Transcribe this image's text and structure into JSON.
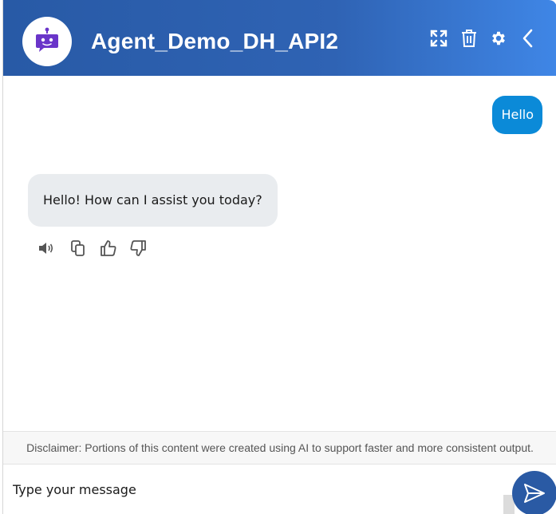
{
  "header": {
    "title": "Agent_Demo_DH_API2",
    "avatar_icon": "robot-icon",
    "actions": [
      "expand-icon",
      "trash-icon",
      "gear-icon",
      "chevron-left-icon"
    ],
    "gradient_start": "#285aa6",
    "gradient_end": "#3f86e6"
  },
  "conversation": {
    "user_message": "Hello",
    "bot_message": "Hello! How can I assist you today?",
    "bot_actions": [
      "speaker-icon",
      "copy-icon",
      "thumbs-up-icon",
      "thumbs-down-icon"
    ],
    "user_bubble_color": "#0b8ad8",
    "bot_bubble_color": "#e9ecef"
  },
  "disclaimer": {
    "text": "Disclaimer: Portions of this content were created using AI to support faster and more consistent output."
  },
  "composer": {
    "placeholder": "Type your message",
    "send_icon": "send-icon",
    "send_color": "#2a5aa4"
  }
}
